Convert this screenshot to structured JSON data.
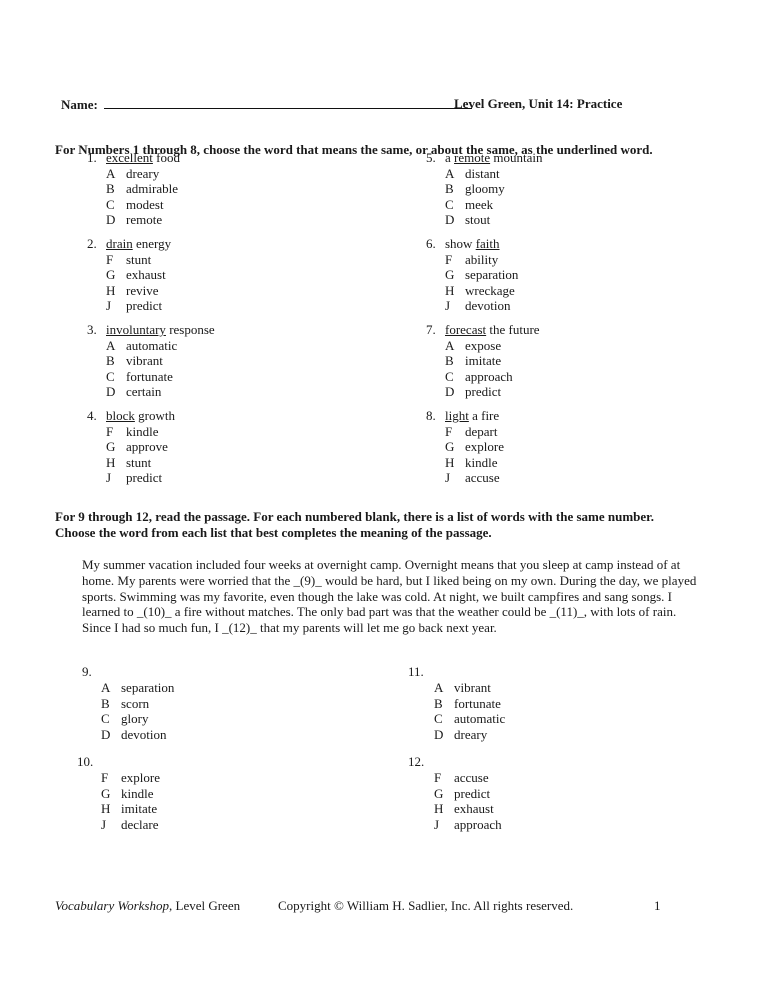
{
  "header": {
    "name_label": "Name:",
    "unit_title": "Level Green, Unit 14: Practice"
  },
  "section1": {
    "instructions": "For Numbers 1 through 8, choose the word that means the same, or about the same, as the underlined word.",
    "questions": [
      {
        "number": "1.",
        "pre": "",
        "underlined": "excellent",
        "post": " food",
        "options": [
          {
            "letter": "A",
            "word": "dreary"
          },
          {
            "letter": "B",
            "word": "admirable"
          },
          {
            "letter": "C",
            "word": "modest"
          },
          {
            "letter": "D",
            "word": "remote"
          }
        ]
      },
      {
        "number": "2.",
        "pre": "",
        "underlined": "drain",
        "post": " energy",
        "options": [
          {
            "letter": "F",
            "word": "stunt"
          },
          {
            "letter": "G",
            "word": "exhaust"
          },
          {
            "letter": "H",
            "word": "revive"
          },
          {
            "letter": "J",
            "word": "predict"
          }
        ]
      },
      {
        "number": "3.",
        "pre": "",
        "underlined": "involuntary",
        "post": " response",
        "options": [
          {
            "letter": "A",
            "word": "automatic"
          },
          {
            "letter": "B",
            "word": "vibrant"
          },
          {
            "letter": "C",
            "word": "fortunate"
          },
          {
            "letter": "D",
            "word": "certain"
          }
        ]
      },
      {
        "number": "4.",
        "pre": "",
        "underlined": "block",
        "post": " growth",
        "options": [
          {
            "letter": "F",
            "word": "kindle"
          },
          {
            "letter": "G",
            "word": "approve"
          },
          {
            "letter": "H",
            "word": "stunt"
          },
          {
            "letter": "J",
            "word": "predict"
          }
        ]
      },
      {
        "number": "5.",
        "pre": "a ",
        "underlined": "remote",
        "post": " mountain",
        "options": [
          {
            "letter": "A",
            "word": "distant"
          },
          {
            "letter": "B",
            "word": "gloomy"
          },
          {
            "letter": "C",
            "word": "meek"
          },
          {
            "letter": "D",
            "word": "stout"
          }
        ]
      },
      {
        "number": "6.",
        "pre": "show ",
        "underlined": "faith",
        "post": "",
        "options": [
          {
            "letter": "F",
            "word": "ability"
          },
          {
            "letter": "G",
            "word": "separation"
          },
          {
            "letter": "H",
            "word": "wreckage"
          },
          {
            "letter": "J",
            "word": "devotion"
          }
        ]
      },
      {
        "number": "7.",
        "pre": "",
        "underlined": "forecast",
        "post": " the future",
        "options": [
          {
            "letter": "A",
            "word": "expose"
          },
          {
            "letter": "B",
            "word": "imitate"
          },
          {
            "letter": "C",
            "word": "approach"
          },
          {
            "letter": "D",
            "word": "predict"
          }
        ]
      },
      {
        "number": "8.",
        "pre": "",
        "underlined": "light",
        "post": " a fire",
        "options": [
          {
            "letter": "F",
            "word": "depart"
          },
          {
            "letter": "G",
            "word": "explore"
          },
          {
            "letter": "H",
            "word": "kindle"
          },
          {
            "letter": "J",
            "word": "accuse"
          }
        ]
      }
    ]
  },
  "section2": {
    "instructions_line1": "For 9 through 12, read the passage. For each numbered blank, there is a list of words with the same number.",
    "instructions_line2": "Choose the word from each list that best completes the meaning of the passage.",
    "passage": "My summer vacation included four weeks at overnight camp. Overnight means that you sleep at camp instead of at home. My parents were worried that the _(9)_ would be hard, but I liked being on my own. During the day, we played sports. Swimming was my favorite, even though the lake was cold. At night, we built campfires and sang songs. I learned to _(10)_ a fire without matches. The only bad part was that the weather could be _(11)_, with lots of rain. Since I had so much fun,  I _(12)_ that my parents will let me go back next year.",
    "questions": [
      {
        "number": "9.",
        "options": [
          {
            "letter": "A",
            "word": "separation"
          },
          {
            "letter": "B",
            "word": "scorn"
          },
          {
            "letter": "C",
            "word": "glory"
          },
          {
            "letter": "D",
            "word": "devotion"
          }
        ]
      },
      {
        "number": "10.",
        "options": [
          {
            "letter": "F",
            "word": "explore"
          },
          {
            "letter": "G",
            "word": "kindle"
          },
          {
            "letter": "H",
            "word": "imitate"
          },
          {
            "letter": "J",
            "word": "declare"
          }
        ]
      },
      {
        "number": "11.",
        "options": [
          {
            "letter": "A",
            "word": "vibrant"
          },
          {
            "letter": "B",
            "word": "fortunate"
          },
          {
            "letter": "C",
            "word": "automatic"
          },
          {
            "letter": "D",
            "word": "dreary"
          }
        ]
      },
      {
        "number": "12.",
        "options": [
          {
            "letter": "F",
            "word": "accuse"
          },
          {
            "letter": "G",
            "word": "predict"
          },
          {
            "letter": "H",
            "word": "exhaust"
          },
          {
            "letter": "J",
            "word": "approach"
          }
        ]
      }
    ]
  },
  "footer": {
    "book_title": "Vocabulary Workshop",
    "book_level": ", Level Green",
    "copyright": "Copyright © William H. Sadlier, Inc. All rights reserved.",
    "page_number": "1"
  }
}
